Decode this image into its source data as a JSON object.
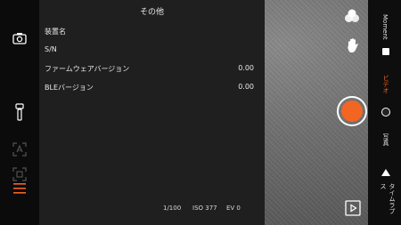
{
  "panel": {
    "title": "その他",
    "rows": [
      {
        "label": "装置名",
        "value": ""
      },
      {
        "label": "S/N",
        "value": ""
      },
      {
        "label": "ファームウェアバージョン",
        "value": "0.00"
      },
      {
        "label": "BLEバージョン",
        "value": "0.00"
      }
    ]
  },
  "status": {
    "shutter_speed": "1/100",
    "iso": "ISO 377",
    "ev": "EV 0"
  },
  "modes": {
    "moment": "Moment",
    "video": "ビデオ",
    "photo": "写真",
    "timelapse": "タイムラプス"
  },
  "colors": {
    "accent": "#f26522",
    "panel_bg": "#1f1f1f"
  },
  "icons": {
    "left": [
      "camera-icon",
      "gimbal-icon",
      "face-track-icon",
      "object-track-icon",
      "menu-icon"
    ],
    "right": [
      "filter-icon",
      "gesture-icon",
      "playback-icon"
    ]
  }
}
